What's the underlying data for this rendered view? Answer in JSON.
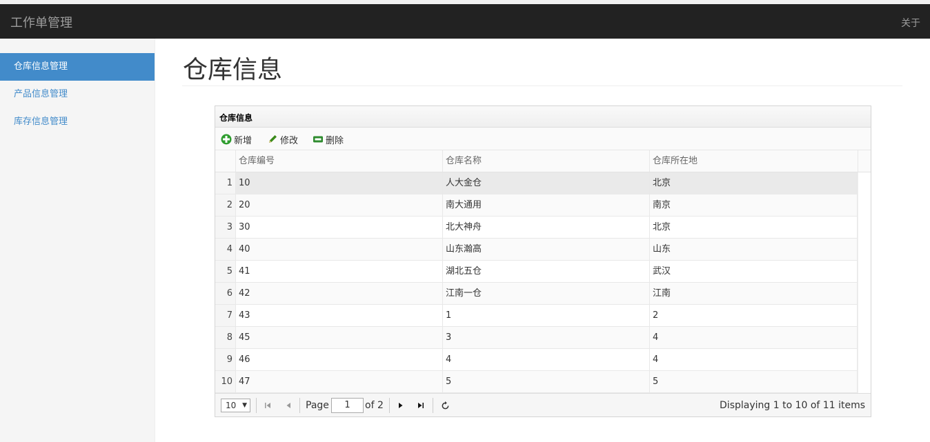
{
  "navbar": {
    "brand": "工作单管理",
    "about": "关于"
  },
  "sidebar": {
    "items": [
      {
        "label": "仓库信息管理",
        "active": true
      },
      {
        "label": "产品信息管理",
        "active": false
      },
      {
        "label": "库存信息管理",
        "active": false
      }
    ]
  },
  "page": {
    "title": "仓库信息"
  },
  "panel": {
    "title": "仓库信息",
    "toolbar": {
      "add": "新增",
      "edit": "修改",
      "delete": "删除"
    },
    "columns": [
      "仓库编号",
      "仓库名称",
      "仓库所在地"
    ],
    "rows": [
      {
        "n": "1",
        "id": "10",
        "name": "人大金仓",
        "loc": "北京"
      },
      {
        "n": "2",
        "id": "20",
        "name": "南大通用",
        "loc": "南京"
      },
      {
        "n": "3",
        "id": "30",
        "name": "北大神舟",
        "loc": "北京"
      },
      {
        "n": "4",
        "id": "40",
        "name": "山东瀚高",
        "loc": "山东"
      },
      {
        "n": "5",
        "id": "41",
        "name": "湖北五仓",
        "loc": "武汉"
      },
      {
        "n": "6",
        "id": "42",
        "name": "江南一仓",
        "loc": "江南"
      },
      {
        "n": "7",
        "id": "43",
        "name": "1",
        "loc": "2"
      },
      {
        "n": "8",
        "id": "45",
        "name": "3",
        "loc": "4"
      },
      {
        "n": "9",
        "id": "46",
        "name": "4",
        "loc": "4"
      },
      {
        "n": "10",
        "id": "47",
        "name": "5",
        "loc": "5"
      }
    ],
    "pager": {
      "page_size": "10",
      "page_label": "Page",
      "page_value": "1",
      "of_label": "of 2",
      "info": "Displaying 1 to 10 of 11 items"
    }
  },
  "colors": {
    "navbar": "#222222",
    "accent": "#428bca",
    "add_icon": "#2e9d2e",
    "edit_icon": "#3a8a1a",
    "delete_icon": "#2e8b2e"
  }
}
